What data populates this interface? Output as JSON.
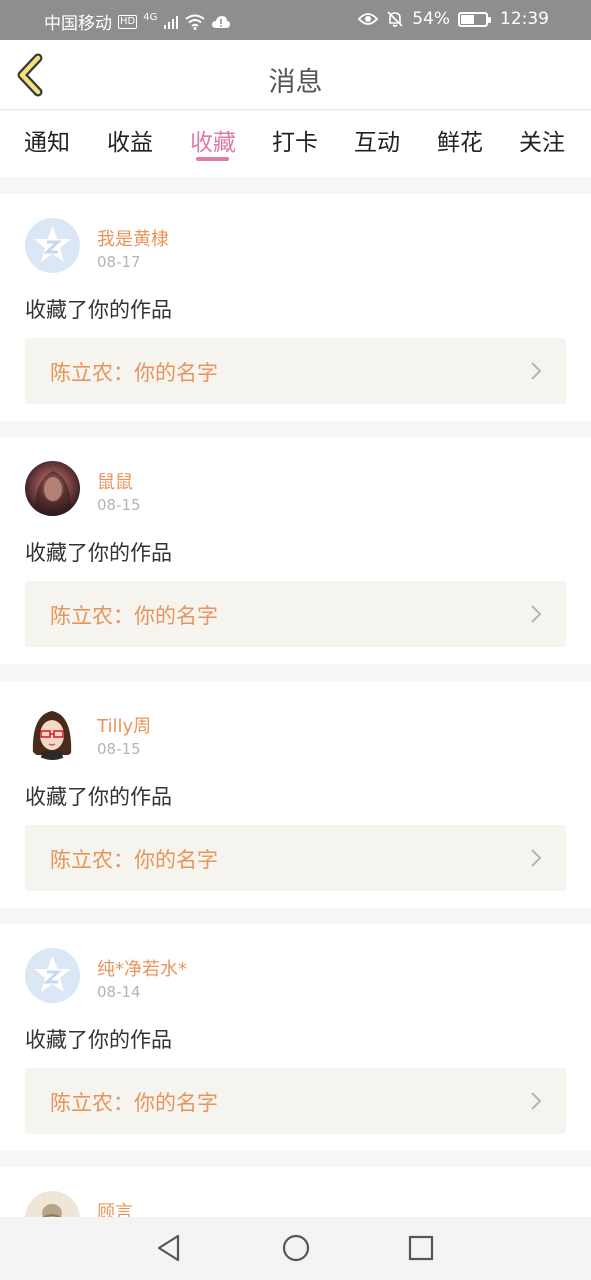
{
  "status_bar": {
    "carrier": "中国移动",
    "hd_badge": "HD",
    "network": "4G",
    "battery_percent": "54%",
    "battery_level": 0.54,
    "time": "12:39"
  },
  "header": {
    "title": "消息",
    "back_icon": "chevron-left-icon"
  },
  "tabs": [
    {
      "label": "通知",
      "active": false
    },
    {
      "label": "收益",
      "active": false
    },
    {
      "label": "收藏",
      "active": true
    },
    {
      "label": "打卡",
      "active": false
    },
    {
      "label": "互动",
      "active": false
    },
    {
      "label": "鲜花",
      "active": false
    },
    {
      "label": "关注",
      "active": false
    }
  ],
  "messages": [
    {
      "user": "我是黄棣",
      "date": "08-17",
      "avatar": "default-avatar-icon",
      "action": "收藏了你的作品",
      "work": "陈立农：你的名字"
    },
    {
      "user": "鼠鼠",
      "date": "08-15",
      "avatar": "photo-avatar",
      "action": "收藏了你的作品",
      "work": "陈立农：你的名字"
    },
    {
      "user": "Tilly周",
      "date": "08-15",
      "avatar": "cartoon-girl-avatar",
      "action": "收藏了你的作品",
      "work": "陈立农：你的名字"
    },
    {
      "user": "纯*净若水*",
      "date": "08-14",
      "avatar": "default-avatar-icon",
      "action": "收藏了你的作品",
      "work": "陈立农：你的名字"
    },
    {
      "user": "顾言",
      "date": "",
      "avatar": "photo-avatar",
      "action": "",
      "work": ""
    }
  ],
  "colors": {
    "accent_pink": "#e07aa9",
    "username_orange": "#e8955c",
    "work_box_bg": "#f5f4ee",
    "page_bg": "#f7f5f5"
  },
  "system_nav": {
    "back": "triangle-back-icon",
    "home": "circle-home-icon",
    "recents": "square-recents-icon"
  }
}
